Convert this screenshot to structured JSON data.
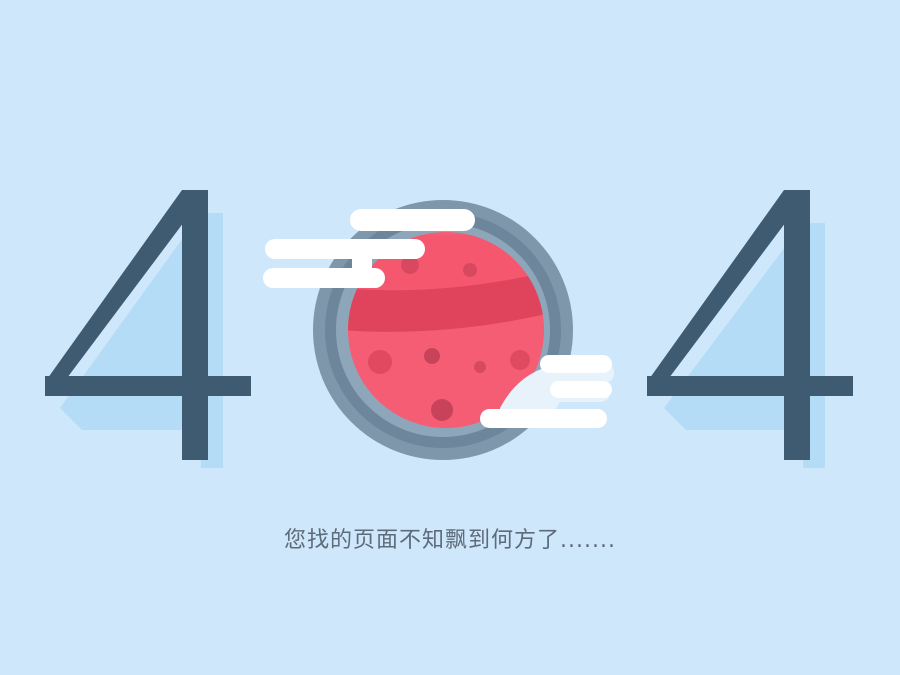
{
  "error_page": {
    "code_digits": [
      "4",
      "4"
    ],
    "message": "您找的页面不知飘到何方了......."
  },
  "colors": {
    "background": "#cfe7fb",
    "digit_dark": "#3f5b72",
    "digit_shadow": "#b4dcf6",
    "planet_red": "#f45d73",
    "planet_band": "#e0445c",
    "ring": "#7f97ab",
    "cloud": "#ffffff",
    "text": "#5d6b7a"
  },
  "icons": [
    "planet-icon",
    "cloud-icon",
    "cloud-icon"
  ]
}
